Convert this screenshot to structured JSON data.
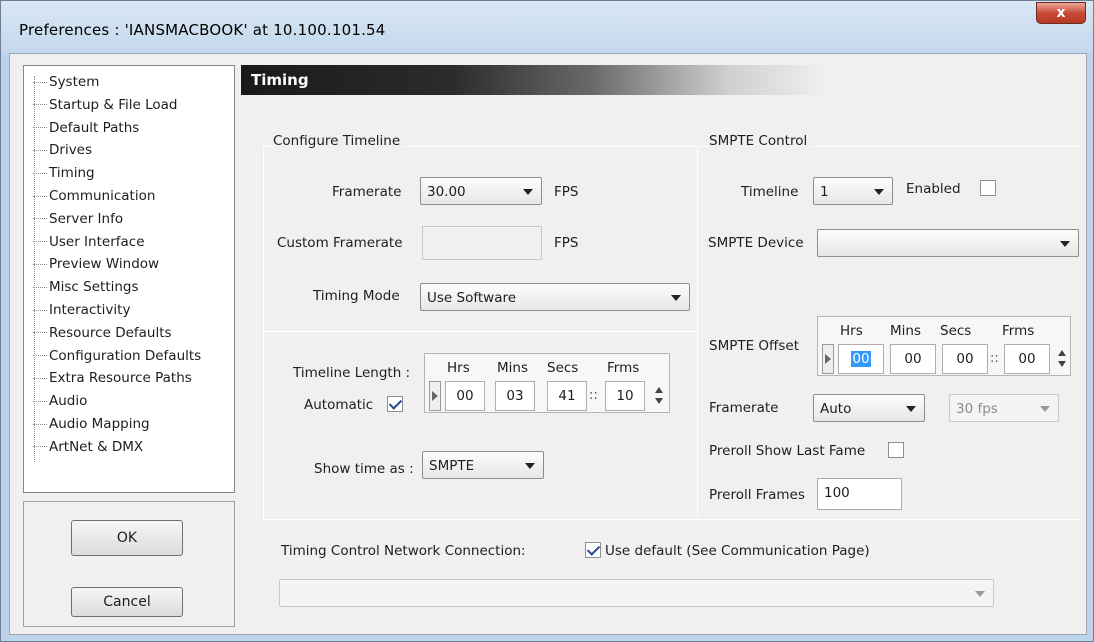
{
  "window": {
    "title": "Preferences  :  'IANSMACBOOK' at 10.100.101.54",
    "close_label": "x"
  },
  "sidebar": {
    "items": [
      {
        "label": "System"
      },
      {
        "label": "Startup & File Load"
      },
      {
        "label": "Default Paths"
      },
      {
        "label": "Drives"
      },
      {
        "label": "Timing"
      },
      {
        "label": "Communication"
      },
      {
        "label": "Server Info"
      },
      {
        "label": "User Interface"
      },
      {
        "label": "Preview Window"
      },
      {
        "label": "Misc Settings"
      },
      {
        "label": "Interactivity"
      },
      {
        "label": "Resource Defaults"
      },
      {
        "label": "Configuration Defaults"
      },
      {
        "label": "Extra Resource Paths"
      },
      {
        "label": "Audio"
      },
      {
        "label": "Audio Mapping"
      },
      {
        "label": "ArtNet & DMX"
      }
    ],
    "selected": "Timing"
  },
  "buttons": {
    "ok": "OK",
    "cancel": "Cancel"
  },
  "page_title": "Timing",
  "configure": {
    "section": "Configure Timeline",
    "framerate_label": "Framerate",
    "framerate_value": "30.00",
    "fps1": "FPS",
    "custom_label": "Custom Framerate",
    "custom_value": "",
    "fps2": "FPS",
    "mode_label": "Timing Mode",
    "mode_value": "Use Software",
    "length_label": "Timeline Length :",
    "automatic_label": "Automatic",
    "automatic_checked": true,
    "length": {
      "hrs_h": "Hrs",
      "mins_h": "Mins",
      "secs_h": "Secs",
      "frms_h": "Frms",
      "hrs": "00",
      "mins": "03",
      "secs": "41",
      "frms": "10",
      "sep": "::"
    },
    "showtime_label": "Show time as :",
    "showtime_value": "SMPTE"
  },
  "smpte": {
    "section": "SMPTE Control",
    "timeline_label": "Timeline",
    "timeline_value": "1",
    "enabled_label": "Enabled",
    "enabled_checked": false,
    "device_label": "SMPTE Device",
    "device_value": "",
    "offset_label": "SMPTE Offset",
    "offset": {
      "hrs_h": "Hrs",
      "mins_h": "Mins",
      "secs_h": "Secs",
      "frms_h": "Frms",
      "hrs": "00",
      "mins": "00",
      "secs": "00",
      "frms": "00",
      "sep": "::"
    },
    "framerate_label": "Framerate",
    "framerate_value": "Auto",
    "fps_value": "30 fps",
    "preroll_last_label": "Preroll Show Last Fame",
    "preroll_last_checked": false,
    "preroll_frames_label": "Preroll Frames",
    "preroll_frames_value": "100"
  },
  "network": {
    "label": "Timing Control Network Connection:",
    "use_default_label": "Use default (See Communication Page)",
    "use_default_checked": true,
    "connection_value": ""
  }
}
